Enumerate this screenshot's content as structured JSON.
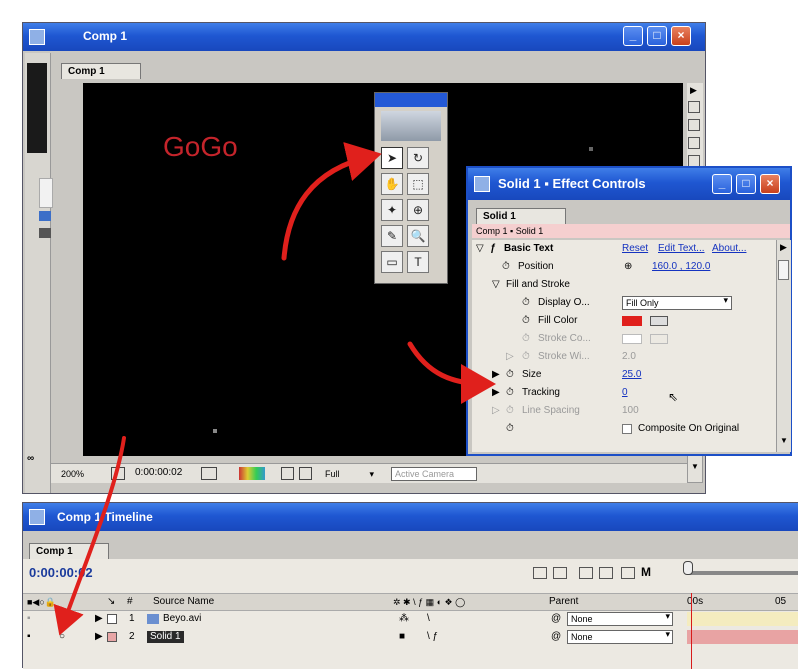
{
  "comp_window": {
    "title": "Comp 1",
    "tab": "Comp 1",
    "canvas_text": "GoGo",
    "footer": {
      "zoom": "200%",
      "timecode": "0:00:00:02",
      "resolution": "Full",
      "camera": "Active Camera"
    }
  },
  "tools_panel": {
    "tools": [
      {
        "name": "selection-tool",
        "glyph": "➤"
      },
      {
        "name": "rotate-tool",
        "glyph": "↻"
      },
      {
        "name": "hand-tool",
        "glyph": "✋"
      },
      {
        "name": "zoom-tool",
        "glyph": "⬚"
      },
      {
        "name": "orbit-tool",
        "glyph": "✦"
      },
      {
        "name": "pan-behind-tool",
        "glyph": "⊕"
      },
      {
        "name": "pen-tool",
        "glyph": "✎"
      },
      {
        "name": "search-tool",
        "glyph": "🔍"
      },
      {
        "name": "mask-tool",
        "glyph": "▭"
      },
      {
        "name": "text-tool",
        "glyph": "T"
      }
    ]
  },
  "effect_controls": {
    "title": "Solid 1 ▪ Effect Controls",
    "tab": "Solid 1",
    "breadcrumb": "Comp 1 ▪ Solid 1",
    "effect_name": "Basic Text",
    "reset": "Reset",
    "edit_text": "Edit Text...",
    "about": "About...",
    "position_label": "Position",
    "position_value": "160.0 , 120.0",
    "fill_stroke": "Fill and Stroke",
    "display_label": "Display O...",
    "display_value": "Fill Only",
    "fill_color": "Fill Color",
    "fill_color_hex": "#e0201c",
    "stroke_color": "Stroke Co...",
    "stroke_width": "Stroke Wi...",
    "stroke_width_value": "2.0",
    "size_label": "Size",
    "size_value": "25.0",
    "tracking_label": "Tracking",
    "tracking_value": "0",
    "line_spacing_label": "Line Spacing",
    "line_spacing_value": "100",
    "composite": "Composite On Original"
  },
  "timeline": {
    "title": "Comp 1 Timeline",
    "tab": "Comp 1",
    "timecode": "0:00:00:02",
    "header": {
      "num": "#",
      "source": "Source Name",
      "parent": "Parent",
      "ruler_start": "00s",
      "ruler_end": "05"
    },
    "layers": [
      {
        "index": "1",
        "name": "Beyo.avi",
        "parent": "None"
      },
      {
        "index": "2",
        "name": "Solid 1",
        "parent": "None"
      }
    ]
  },
  "colors": {
    "xp_title": "#2459d6",
    "canvas": "#000000",
    "arrow": "#e0201c",
    "gogo_text": "#c4242b"
  }
}
